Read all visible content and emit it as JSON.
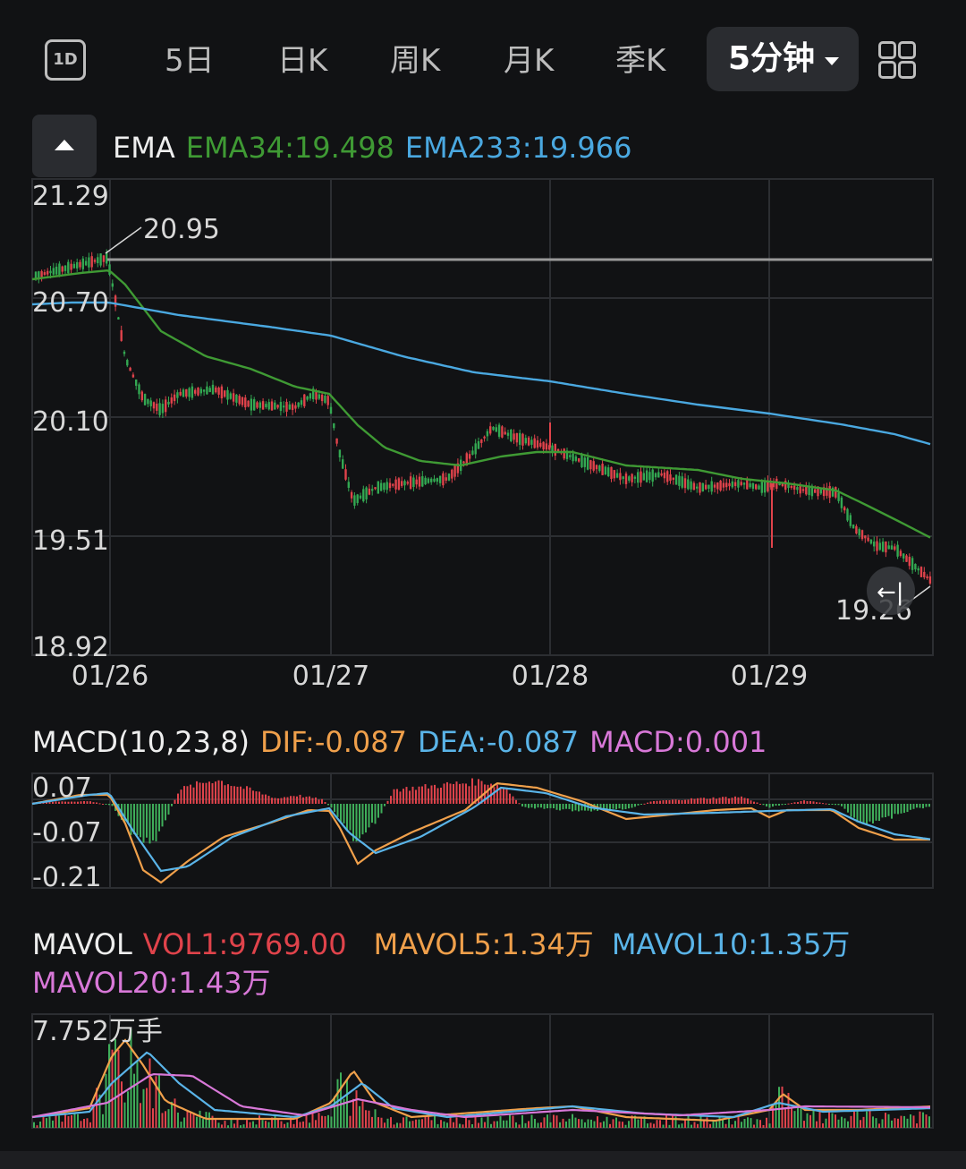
{
  "tabs": {
    "intraday_icon": "1D",
    "items": [
      "5日",
      "日K",
      "周K",
      "月K",
      "季K"
    ],
    "active": "5分钟",
    "more_icon": "grid-icon"
  },
  "main": {
    "indicator": "EMA",
    "ema34": "EMA34:19.498",
    "ema233": "EMA233:19.966",
    "colors": {
      "ema34": "#3f9a34",
      "ema233": "#4aa8e0",
      "up": "#e0434b",
      "down": "#33a852"
    },
    "y_ticks": [
      "21.29",
      "20.70",
      "20.10",
      "19.51",
      "18.92"
    ],
    "x_ticks": [
      "01/26",
      "01/27",
      "01/28",
      "01/29"
    ],
    "high_label": "20.95",
    "low_label": "19.26",
    "back_icon": "back-to-latest-icon"
  },
  "macd": {
    "title": "MACD(10,23,8)",
    "dif": "DIF:-0.087",
    "dea": "DEA:-0.087",
    "macd": "MACD:0.001",
    "y_ticks": [
      "0.07",
      "-0.07",
      "-0.21"
    ],
    "colors": {
      "dif": "#f0a04b",
      "dea": "#5ab4e8",
      "macd": "#d878d8"
    }
  },
  "mavol": {
    "title": "MAVOL",
    "vol1": "VOL1:9769.00",
    "mavol5": "MAVOL5:1.34万",
    "mavol10": "MAVOL10:1.35万",
    "mavol20": "MAVOL20:1.43万",
    "max_label": "7.752万手",
    "colors": {
      "vol1": "#e0434b",
      "mavol5": "#f0a04b",
      "mavol10": "#5ab4e8",
      "mavol20": "#d878d8"
    }
  },
  "chart_data": [
    {
      "type": "line",
      "title": "EMA",
      "x": [
        "01/26",
        "01/27",
        "01/28",
        "01/29"
      ],
      "ylim": [
        18.92,
        21.29
      ],
      "grid": true,
      "series": [
        {
          "name": "EMA34",
          "values": [
            20.8,
            20.15,
            19.8,
            19.7,
            19.5
          ]
        },
        {
          "name": "EMA233",
          "values": [
            20.71,
            20.5,
            20.28,
            20.1,
            19.97
          ]
        }
      ],
      "annotations": [
        "20.95",
        "19.26"
      ]
    },
    {
      "type": "line",
      "title": "MACD(10,23,8)",
      "ylim": [
        -0.21,
        0.07
      ],
      "series": [
        {
          "name": "DIF",
          "values": [
            0.0,
            -0.21,
            -0.05,
            -0.03,
            -0.15,
            0.05,
            0.02,
            -0.02,
            -0.04,
            -0.087
          ]
        },
        {
          "name": "DEA",
          "values": [
            0.0,
            -0.19,
            -0.06,
            -0.02,
            -0.13,
            0.03,
            0.02,
            -0.01,
            -0.03,
            -0.087
          ]
        }
      ]
    },
    {
      "type": "bar",
      "title": "MAVOL",
      "ylim": [
        0,
        7.752
      ],
      "series": [
        {
          "name": "MAVOL5",
          "values": [
            0.5,
            5.6,
            1.0,
            0.5,
            3.2,
            0.6,
            0.8,
            1.1,
            0.134
          ]
        },
        {
          "name": "MAVOL10",
          "values": [
            0.5,
            4.8,
            1.5,
            0.5,
            2.6,
            0.7,
            0.7,
            0.9,
            0.135
          ]
        },
        {
          "name": "MAVOL20",
          "values": [
            0.5,
            3.3,
            2.0,
            0.7,
            1.5,
            0.8,
            0.7,
            0.8,
            0.143
          ]
        }
      ]
    }
  ]
}
